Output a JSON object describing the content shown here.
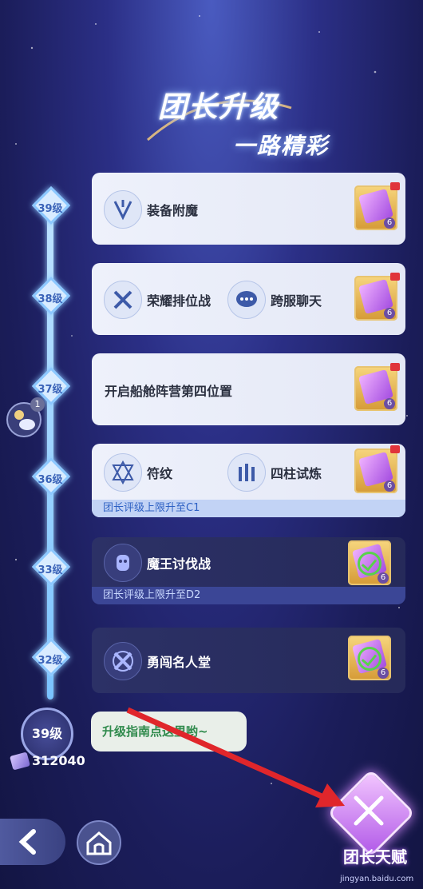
{
  "title": {
    "line1": "团长升级",
    "line2": "一路精彩"
  },
  "timeline": [
    {
      "level": "39级",
      "features": [
        {
          "icon": "enchant-icon",
          "label": "装备附魔"
        }
      ],
      "reward_count": "6",
      "claimed": false,
      "strip": ""
    },
    {
      "level": "38级",
      "features": [
        {
          "icon": "ranked-battle-icon",
          "label": "荣耀排位战"
        },
        {
          "icon": "chat-bubble-icon",
          "label": "跨服聊天"
        }
      ],
      "reward_count": "6",
      "claimed": false,
      "strip": ""
    },
    {
      "level": "37级",
      "features": [
        {
          "icon": "",
          "label": "开启船舱阵营第四位置"
        }
      ],
      "reward_count": "6",
      "claimed": false,
      "strip": ""
    },
    {
      "level": "36级",
      "features": [
        {
          "icon": "rune-icon",
          "label": "符纹"
        },
        {
          "icon": "pillar-trial-icon",
          "label": "四柱试炼"
        }
      ],
      "reward_count": "6",
      "claimed": false,
      "strip": "团长评级上限升至C1"
    },
    {
      "level": "33级",
      "features": [
        {
          "icon": "demon-king-icon",
          "label": "魔王讨伐战"
        }
      ],
      "reward_count": "6",
      "claimed": true,
      "strip": "团长评级上限升至D2"
    },
    {
      "level": "32级",
      "features": [
        {
          "icon": "hall-of-fame-icon",
          "label": "勇闯名人堂"
        }
      ],
      "reward_count": "6",
      "claimed": true,
      "strip": ""
    }
  ],
  "current": {
    "level": "39级",
    "exp": "312040",
    "tip": "升级指南点这里哟~"
  },
  "chat_badge": "1",
  "talent_label": "团长天赋",
  "watermark": "jingyan.baidu.com"
}
